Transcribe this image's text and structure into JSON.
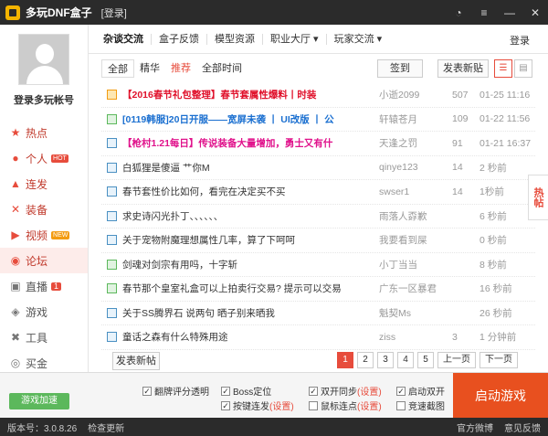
{
  "titlebar": {
    "app_name": "多玩DNF盒子",
    "login_tag": "[登录]"
  },
  "sidebar": {
    "login_label": "登录多玩帐号",
    "items": [
      {
        "label": "热点",
        "icon": "star-icon",
        "badge": ""
      },
      {
        "label": "个人",
        "icon": "person-icon",
        "badge": "HOT"
      },
      {
        "label": "连发",
        "icon": "apps-icon",
        "badge": ""
      },
      {
        "label": "装备",
        "icon": "sword-icon",
        "badge": ""
      },
      {
        "label": "视频",
        "icon": "video-icon",
        "badge": "NEW"
      },
      {
        "label": "论坛",
        "icon": "chat-icon",
        "badge": ""
      },
      {
        "label": "直播",
        "icon": "live-icon",
        "badge": "1"
      },
      {
        "label": "游戏",
        "icon": "gamepad-icon",
        "badge": ""
      },
      {
        "label": "工具",
        "icon": "tools-icon",
        "badge": ""
      },
      {
        "label": "买金",
        "icon": "coins-icon",
        "badge": ""
      }
    ]
  },
  "tabs": {
    "items": [
      "杂谈交流",
      "盒子反馈",
      "模型资源",
      "职业大厅",
      "玩家交流"
    ],
    "login": "登录"
  },
  "filters": {
    "items": [
      "全部",
      "精华",
      "推荐",
      "全部时间"
    ],
    "signin": "签到",
    "newpost": "发表新贴"
  },
  "posts": [
    {
      "title": "【2016春节礼包整理】春节套属性爆料丨时装",
      "author": "小逝2099",
      "count": "507",
      "time": "01-25 11:16"
    },
    {
      "title": "[0119韩服]20日开服——宽屏未袭 丨 UI改版 丨 公",
      "author": "轩辕苍月",
      "count": "109",
      "time": "01-22 11:56"
    },
    {
      "title": "【枪村1.21每日】传说装备大量增加，勇士又有什",
      "author": "天逢之罚",
      "count": "91",
      "time": "01-21 16:37"
    },
    {
      "title": "白狐狸是傻逼 艹你M",
      "author": "qinye123",
      "count": "14",
      "time": "2 秒前"
    },
    {
      "title": "春节套性价比如何，看完在决定买不买",
      "author": "swser1",
      "count": "14",
      "time": "1秒前"
    },
    {
      "title": "求史诗闪光扑丁、、、、、、",
      "author": "雨落人孬歉",
      "count": "",
      "time": "6 秒前"
    },
    {
      "title": "关于宠物附魔理想属性几率，算了下呵呵",
      "author": "我要看到屎",
      "count": "",
      "time": "0 秒前"
    },
    {
      "title": "剑魂对剑宗有用吗，十字斩",
      "author": "小丁当当",
      "count": "",
      "time": "8 秒前"
    },
    {
      "title": "春节那个皇室礼盒可以上拍卖行交易? 提示可以交易",
      "author": "广东一区暴君",
      "count": "",
      "time": "16 秒前"
    },
    {
      "title": "关于SS腾界石 说两句 晒子别来晒我",
      "author": "魁契Ms",
      "count": "",
      "time": "26 秒前"
    },
    {
      "title": "童话之森有什么特殊用途",
      "author": "ziss",
      "count": "3",
      "time": "1 分钟前"
    }
  ],
  "side_tab": "热帖",
  "pager": {
    "newpost": "发表新帖",
    "pages": [
      "1",
      "2",
      "3",
      "4",
      "5"
    ],
    "prev": "上一页",
    "next": "下一页"
  },
  "bottom": {
    "accel": "游戏加速",
    "opts": [
      {
        "label": "翻牌评分透明",
        "setting": ""
      },
      {
        "label": "Boss定位",
        "setting": ""
      },
      {
        "label": "双开同步",
        "setting": "(设置)"
      },
      {
        "label": "启动双开",
        "setting": ""
      },
      {
        "label": "按键连发",
        "setting": "(设置)"
      },
      {
        "label": "鼠标连点",
        "setting": "(设置)"
      },
      {
        "label": "竞速截图",
        "setting": ""
      }
    ],
    "start": "启动游戏"
  },
  "status": {
    "version": "版本号：3.0.8.26",
    "update": "检查更新",
    "weibo": "官方微博",
    "feedback": "意见反馈"
  },
  "colors": {
    "accent": "#e74c3c",
    "start": "#e8501f",
    "titlebar": "#2b2b2b"
  }
}
